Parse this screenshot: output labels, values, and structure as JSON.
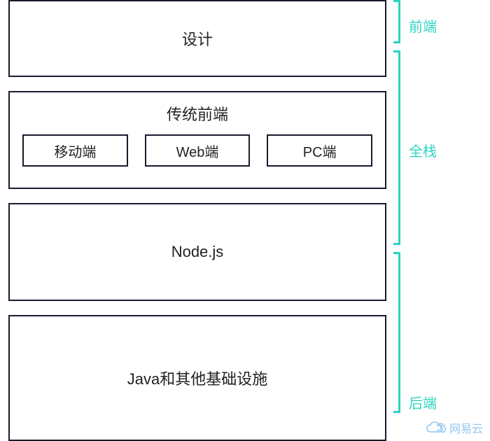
{
  "blocks": {
    "design": "设计",
    "traditional_frontend": "传统前端",
    "mobile": "移动端",
    "web": "Web端",
    "pc": "PC端",
    "nodejs": "Node.js",
    "infra": "Java和其他基础设施"
  },
  "brackets": {
    "frontend": "前端",
    "fullstack": "全栈",
    "backend": "后端"
  },
  "watermark": "网易云",
  "colors": {
    "accent": "#2dd4bf",
    "border": "#1a1a2e"
  }
}
